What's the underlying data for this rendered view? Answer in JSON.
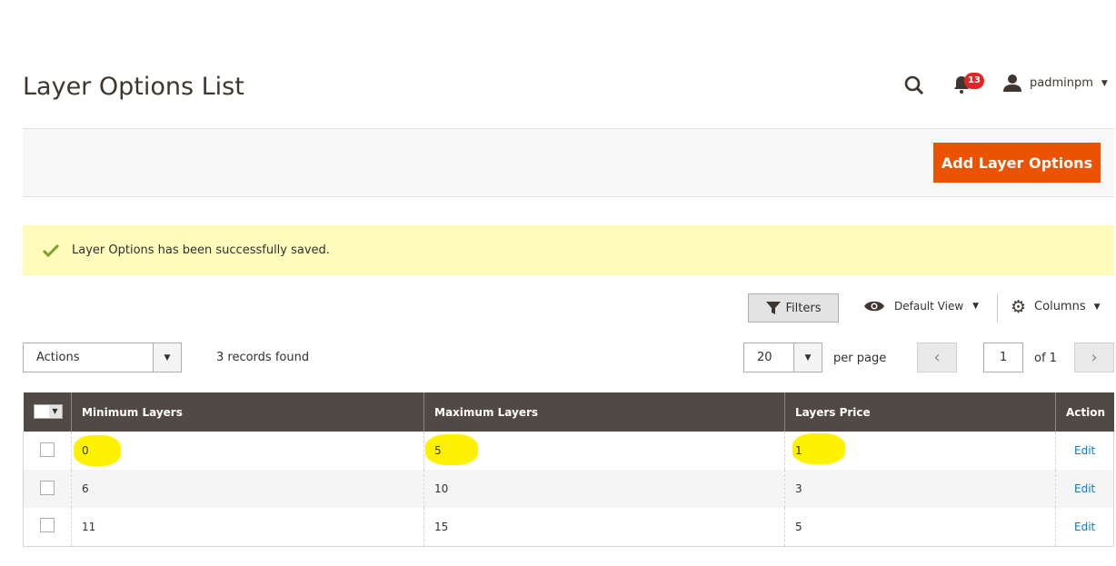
{
  "header": {
    "title": "Layer Options List",
    "notifications_count": "13",
    "username": "padminpm"
  },
  "toolbar": {
    "add_label": "Add Layer Options"
  },
  "message": {
    "text": "Layer Options has been successfully saved."
  },
  "grid": {
    "filters_label": "Filters",
    "view_label": "Default View",
    "columns_label": "Columns",
    "actions_label": "Actions",
    "records_found": "3 records found",
    "per_page_value": "20",
    "per_page_label": "per page",
    "page_current": "1",
    "page_of": "of 1",
    "columns": [
      "Minimum Layers",
      "Maximum Layers",
      "Layers Price",
      "Action"
    ],
    "rows": [
      {
        "min": "0",
        "max": "5",
        "price": "1",
        "action": "Edit"
      },
      {
        "min": "6",
        "max": "10",
        "price": "3",
        "action": "Edit"
      },
      {
        "min": "11",
        "max": "15",
        "price": "5",
        "action": "Edit"
      }
    ]
  },
  "colors": {
    "accent": "#eb5202",
    "table_header": "#514943",
    "message_bg": "#fffbbb",
    "highlight": "#fff200"
  }
}
